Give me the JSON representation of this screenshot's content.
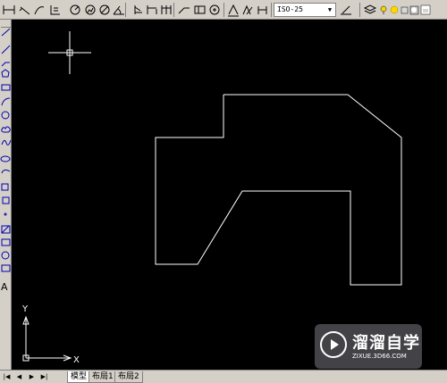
{
  "toolbar": {
    "dimstyle_value": "ISO-25"
  },
  "canvas": {
    "background": "#000000",
    "drawing_color": "#ffffff",
    "ucs_x_label": "X",
    "ucs_y_label": "Y"
  },
  "tabs": {
    "items": [
      {
        "label": "模型",
        "active": true
      },
      {
        "label": "布局1",
        "active": false
      },
      {
        "label": "布局2",
        "active": false
      }
    ]
  },
  "watermark": {
    "title": "溜溜自学",
    "subtitle": "ZIXUE.3D66.COM"
  }
}
